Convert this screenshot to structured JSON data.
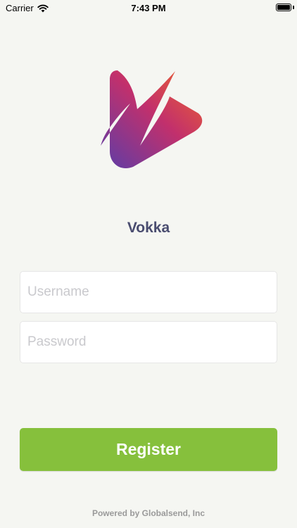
{
  "status_bar": {
    "carrier": "Carrier",
    "time": "7:43 PM"
  },
  "app": {
    "name": "Vokka"
  },
  "form": {
    "username_placeholder": "Username",
    "password_placeholder": "Password",
    "register_label": "Register"
  },
  "footer": {
    "text": "Powered by Globalsend, Inc"
  },
  "colors": {
    "background": "#f5f6f2",
    "accent_green": "#86c03c",
    "title": "#4a4d70",
    "logo_gradient": [
      "#5b3da8",
      "#c2306c",
      "#f0662a"
    ]
  },
  "icons": [
    "wifi-icon",
    "battery-icon",
    "app-logo"
  ]
}
